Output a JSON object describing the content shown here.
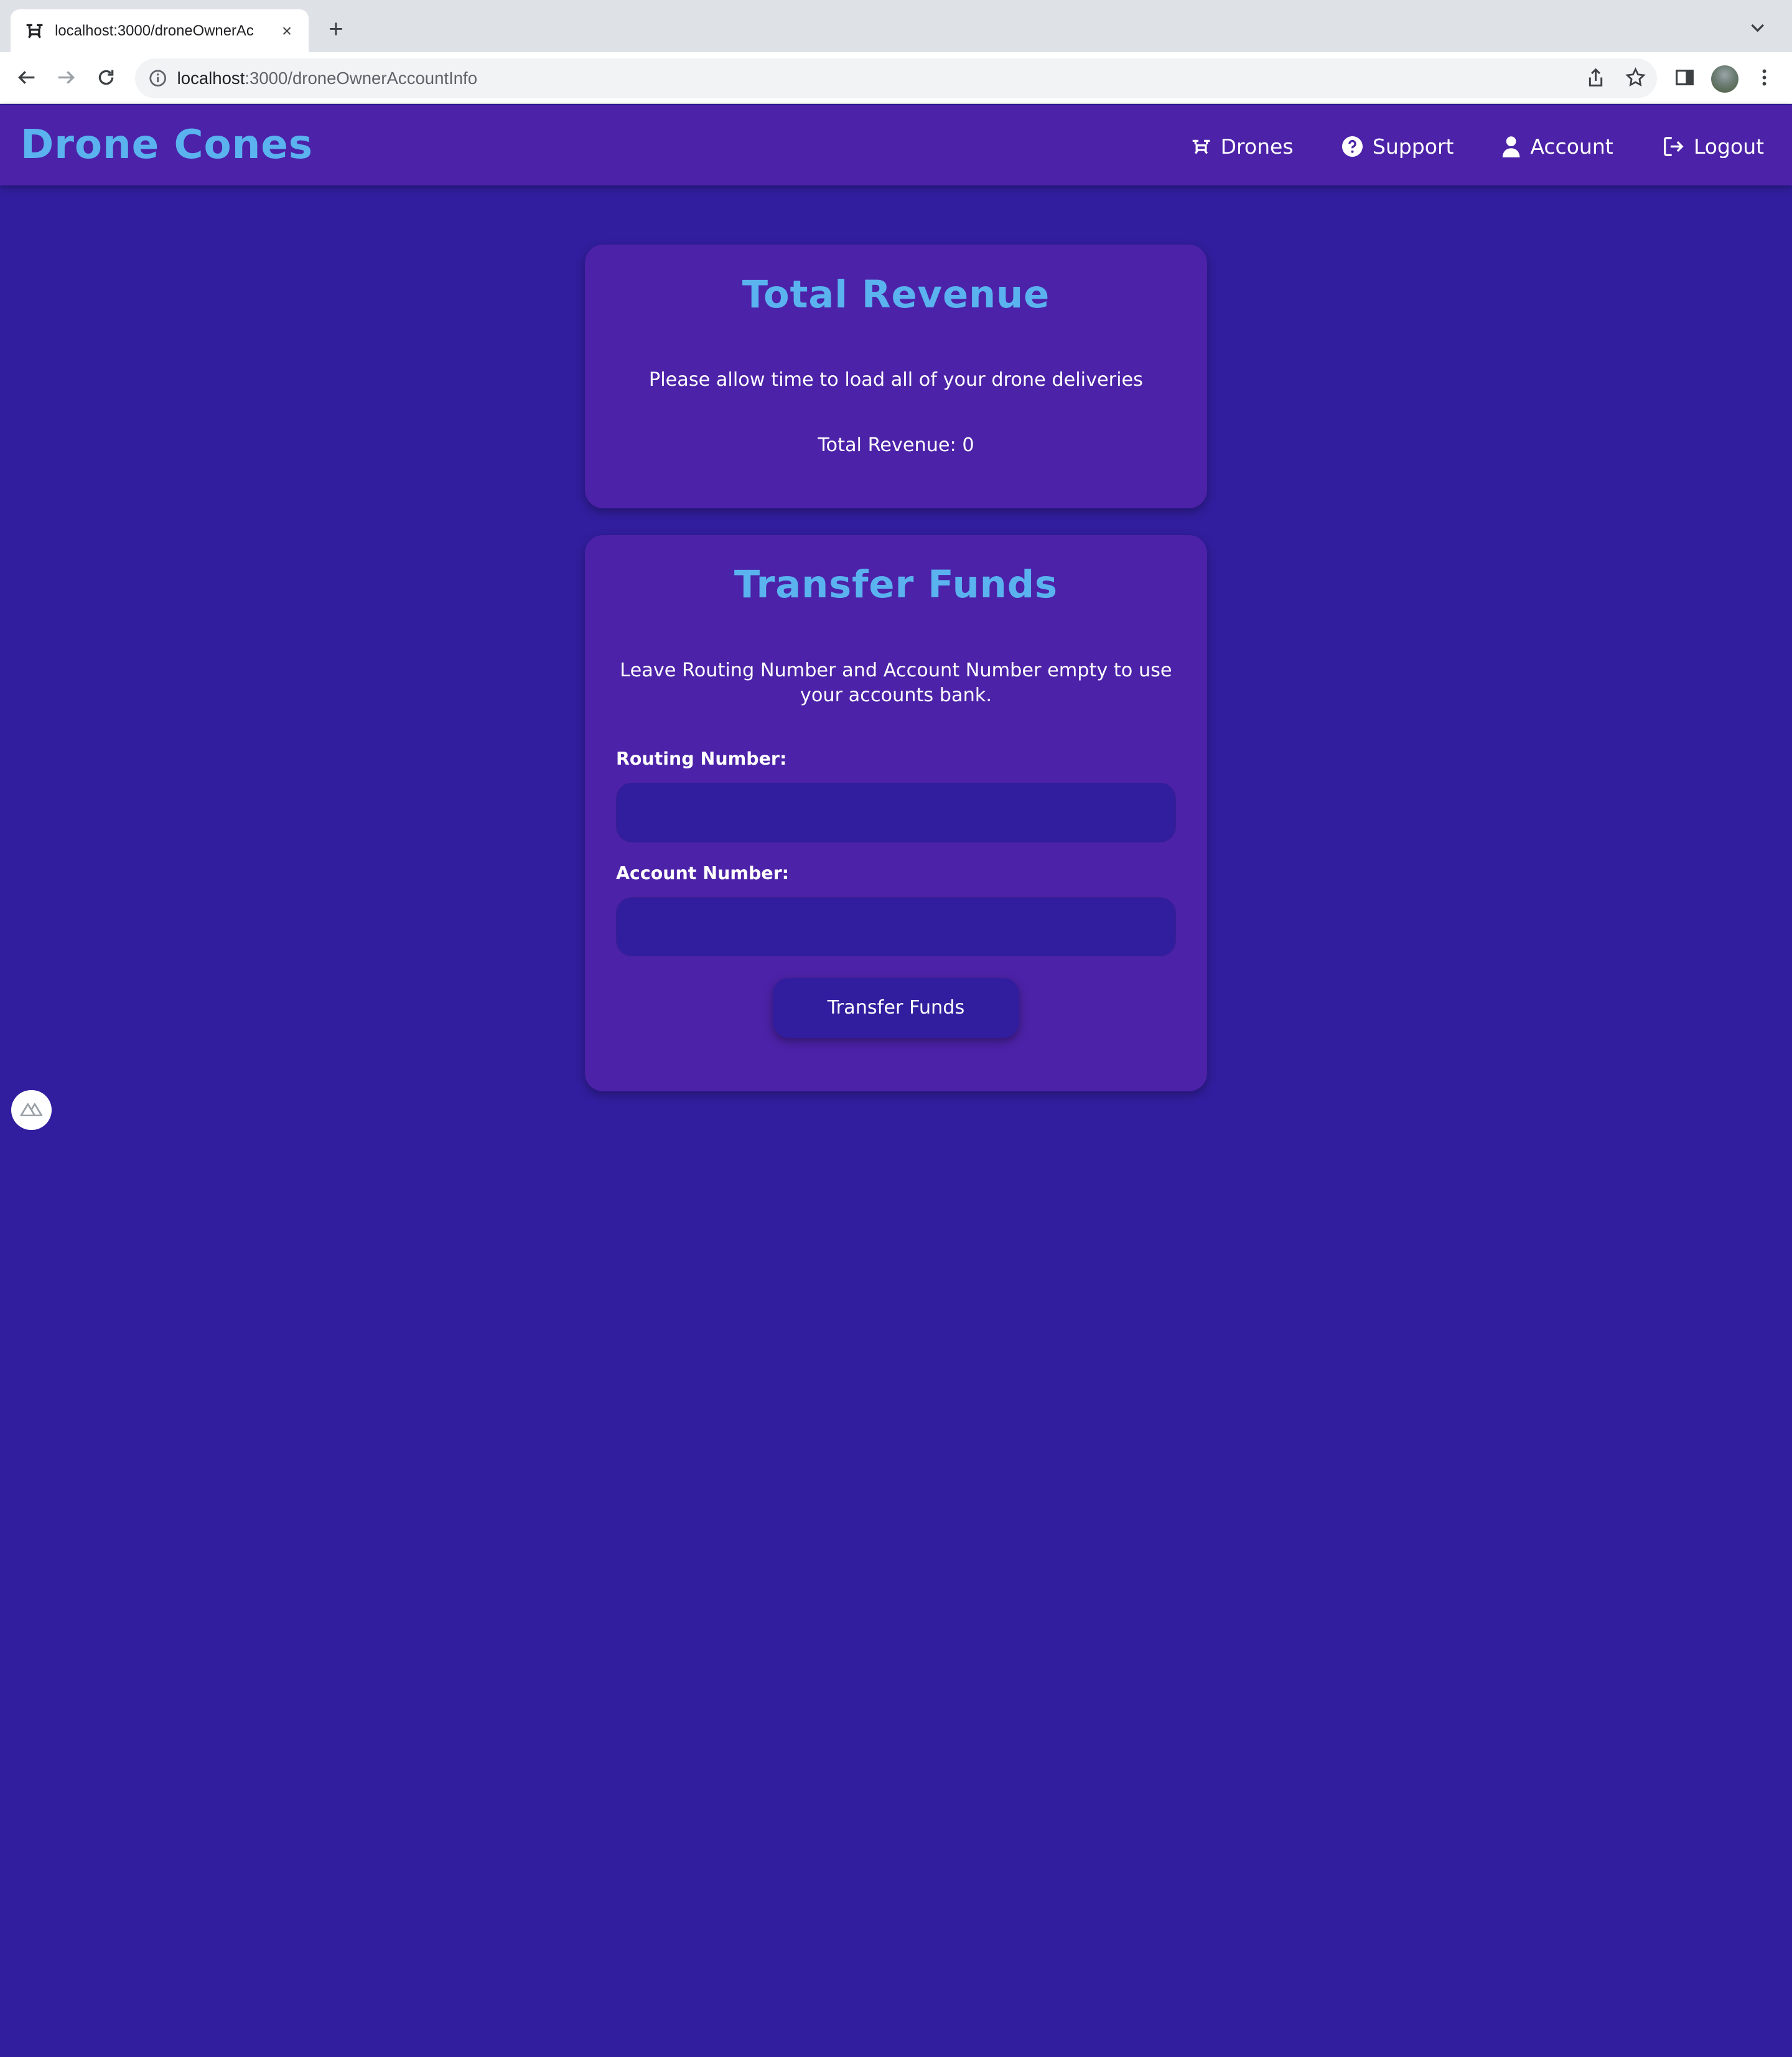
{
  "browser": {
    "tab_title": "localhost:3000/droneOwnerAc",
    "tab_close": "×",
    "new_tab": "+",
    "url_host": "localhost",
    "url_path": ":3000/droneOwnerAccountInfo"
  },
  "nav": {
    "brand": "Drone Cones",
    "items": [
      {
        "label": "Drones",
        "icon": "drone-icon"
      },
      {
        "label": "Support",
        "icon": "help-circle-icon"
      },
      {
        "label": "Account",
        "icon": "user-icon"
      },
      {
        "label": "Logout",
        "icon": "logout-icon"
      }
    ]
  },
  "revenue_card": {
    "title": "Total Revenue",
    "notice": "Please allow time to load all of your drone deliveries",
    "total_label": "Total Revenue: 0"
  },
  "transfer_card": {
    "title": "Transfer Funds",
    "notice": "Leave Routing Number and Account Number empty to use your accounts bank.",
    "routing_label": "Routing Number:",
    "routing_value": "",
    "account_label": "Account Number:",
    "account_value": "",
    "submit_label": "Transfer Funds"
  },
  "colors": {
    "page_bg": "#311e9e",
    "nav_bg": "#4c22a8",
    "card_bg": "#4c22a8",
    "accent": "#5ab3ee",
    "text": "#ffffff"
  }
}
